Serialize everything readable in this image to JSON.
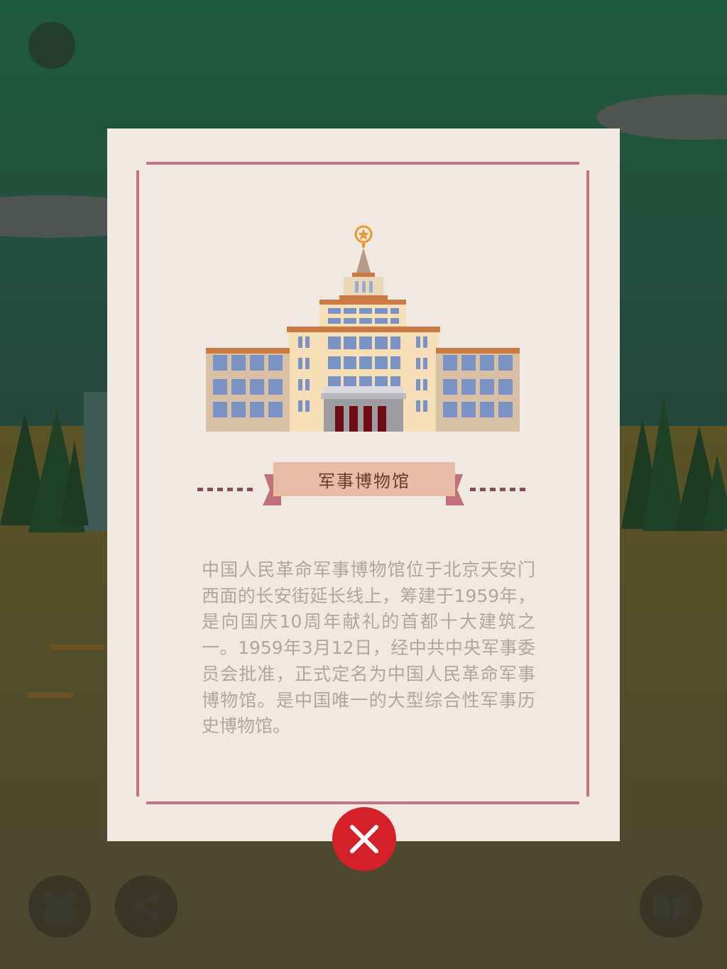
{
  "modal": {
    "title": "军事博物馆",
    "description": "中国人民革命军事博物馆位于北京天安门西面的长安街延长线上，筹建于1959年，是向国庆10周年献礼的首都十大建筑之一。1959年3月12日，经中共中央军事委员会批准，正式定名为中国人民革命军事博物馆。是中国唯一的大型综合性军事历史博物馆。"
  },
  "icons": {
    "back": "chevron-left-icon",
    "close": "close-icon",
    "character": "character-icon",
    "share": "share-icon",
    "book": "book-icon",
    "landmark": "military-museum-illustration"
  },
  "colors": {
    "frame": "#c4757a",
    "modal_bg": "#f2e8e2",
    "ribbon": "#e7bba5",
    "close": "#d42028",
    "description_text": "#b3a4a0"
  }
}
